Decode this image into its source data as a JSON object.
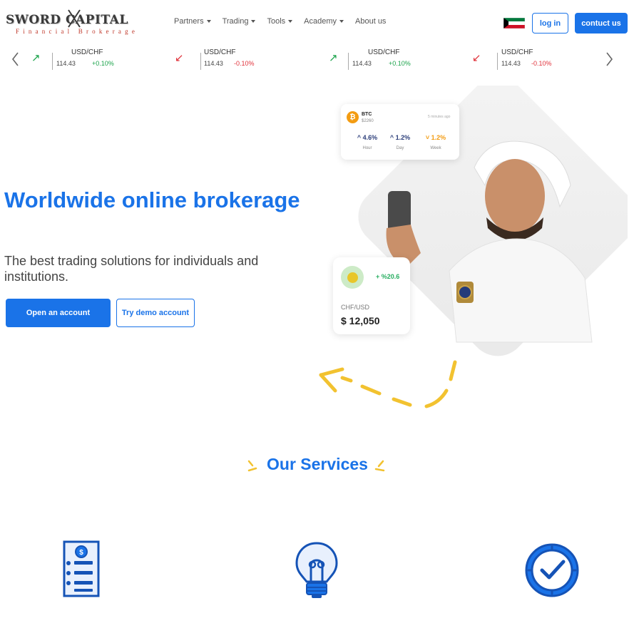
{
  "header": {
    "logo_main": "SWORD CAPITAL",
    "logo_sub": "Financial Brokerage",
    "nav": [
      {
        "label": "Partners",
        "dropdown": true
      },
      {
        "label": "Trading",
        "dropdown": true
      },
      {
        "label": "Tools",
        "dropdown": true
      },
      {
        "label": "Academy",
        "dropdown": true
      },
      {
        "label": "About us",
        "dropdown": false
      }
    ],
    "flag": "kuwait-flag",
    "login_label": "log in",
    "contact_label": "contuct us"
  },
  "ticker": {
    "items": [
      {
        "pair": "USD/CHF",
        "price": "114.43",
        "change": "+0.10%",
        "direction": "up"
      },
      {
        "pair": "USD/CHF",
        "price": "114.43",
        "change": "-0.10%",
        "direction": "down"
      },
      {
        "pair": "USD/CHF",
        "price": "114.43",
        "change": "+0.10%",
        "direction": "up"
      },
      {
        "pair": "USD/CHF",
        "price": "114.43",
        "change": "-0.10%",
        "direction": "down"
      }
    ],
    "colors": {
      "up": "#1aa34a",
      "down": "#e0313a"
    }
  },
  "hero": {
    "title": "Worldwide online brokerage",
    "subtitle": "The best trading solutions for individuals and institutions.",
    "primary_button": "Open an account",
    "secondary_button": "Try demo account"
  },
  "btc_card": {
    "name": "BTC",
    "price": "$2260",
    "time": "5 minutes ago",
    "stats": [
      {
        "value": "4.6%",
        "label": "Hour",
        "color": "#2c3e7a",
        "arrow": "^"
      },
      {
        "value": "1.2%",
        "label": "Day",
        "color": "#2c3e7a",
        "arrow": "^"
      },
      {
        "value": "1.2%",
        "label": "Week",
        "color": "#f39c12",
        "arrow": "v"
      }
    ]
  },
  "chf_card": {
    "change": "+ %20.6",
    "pair": "CHF/USD",
    "price": "$ 12,050"
  },
  "services": {
    "title": "Our Services",
    "icons": [
      "invoice-icon",
      "lightbulb-icon",
      "clock-check-icon"
    ]
  },
  "colors": {
    "brand": "#1a73e8",
    "accent_yellow": "#f2c230"
  }
}
